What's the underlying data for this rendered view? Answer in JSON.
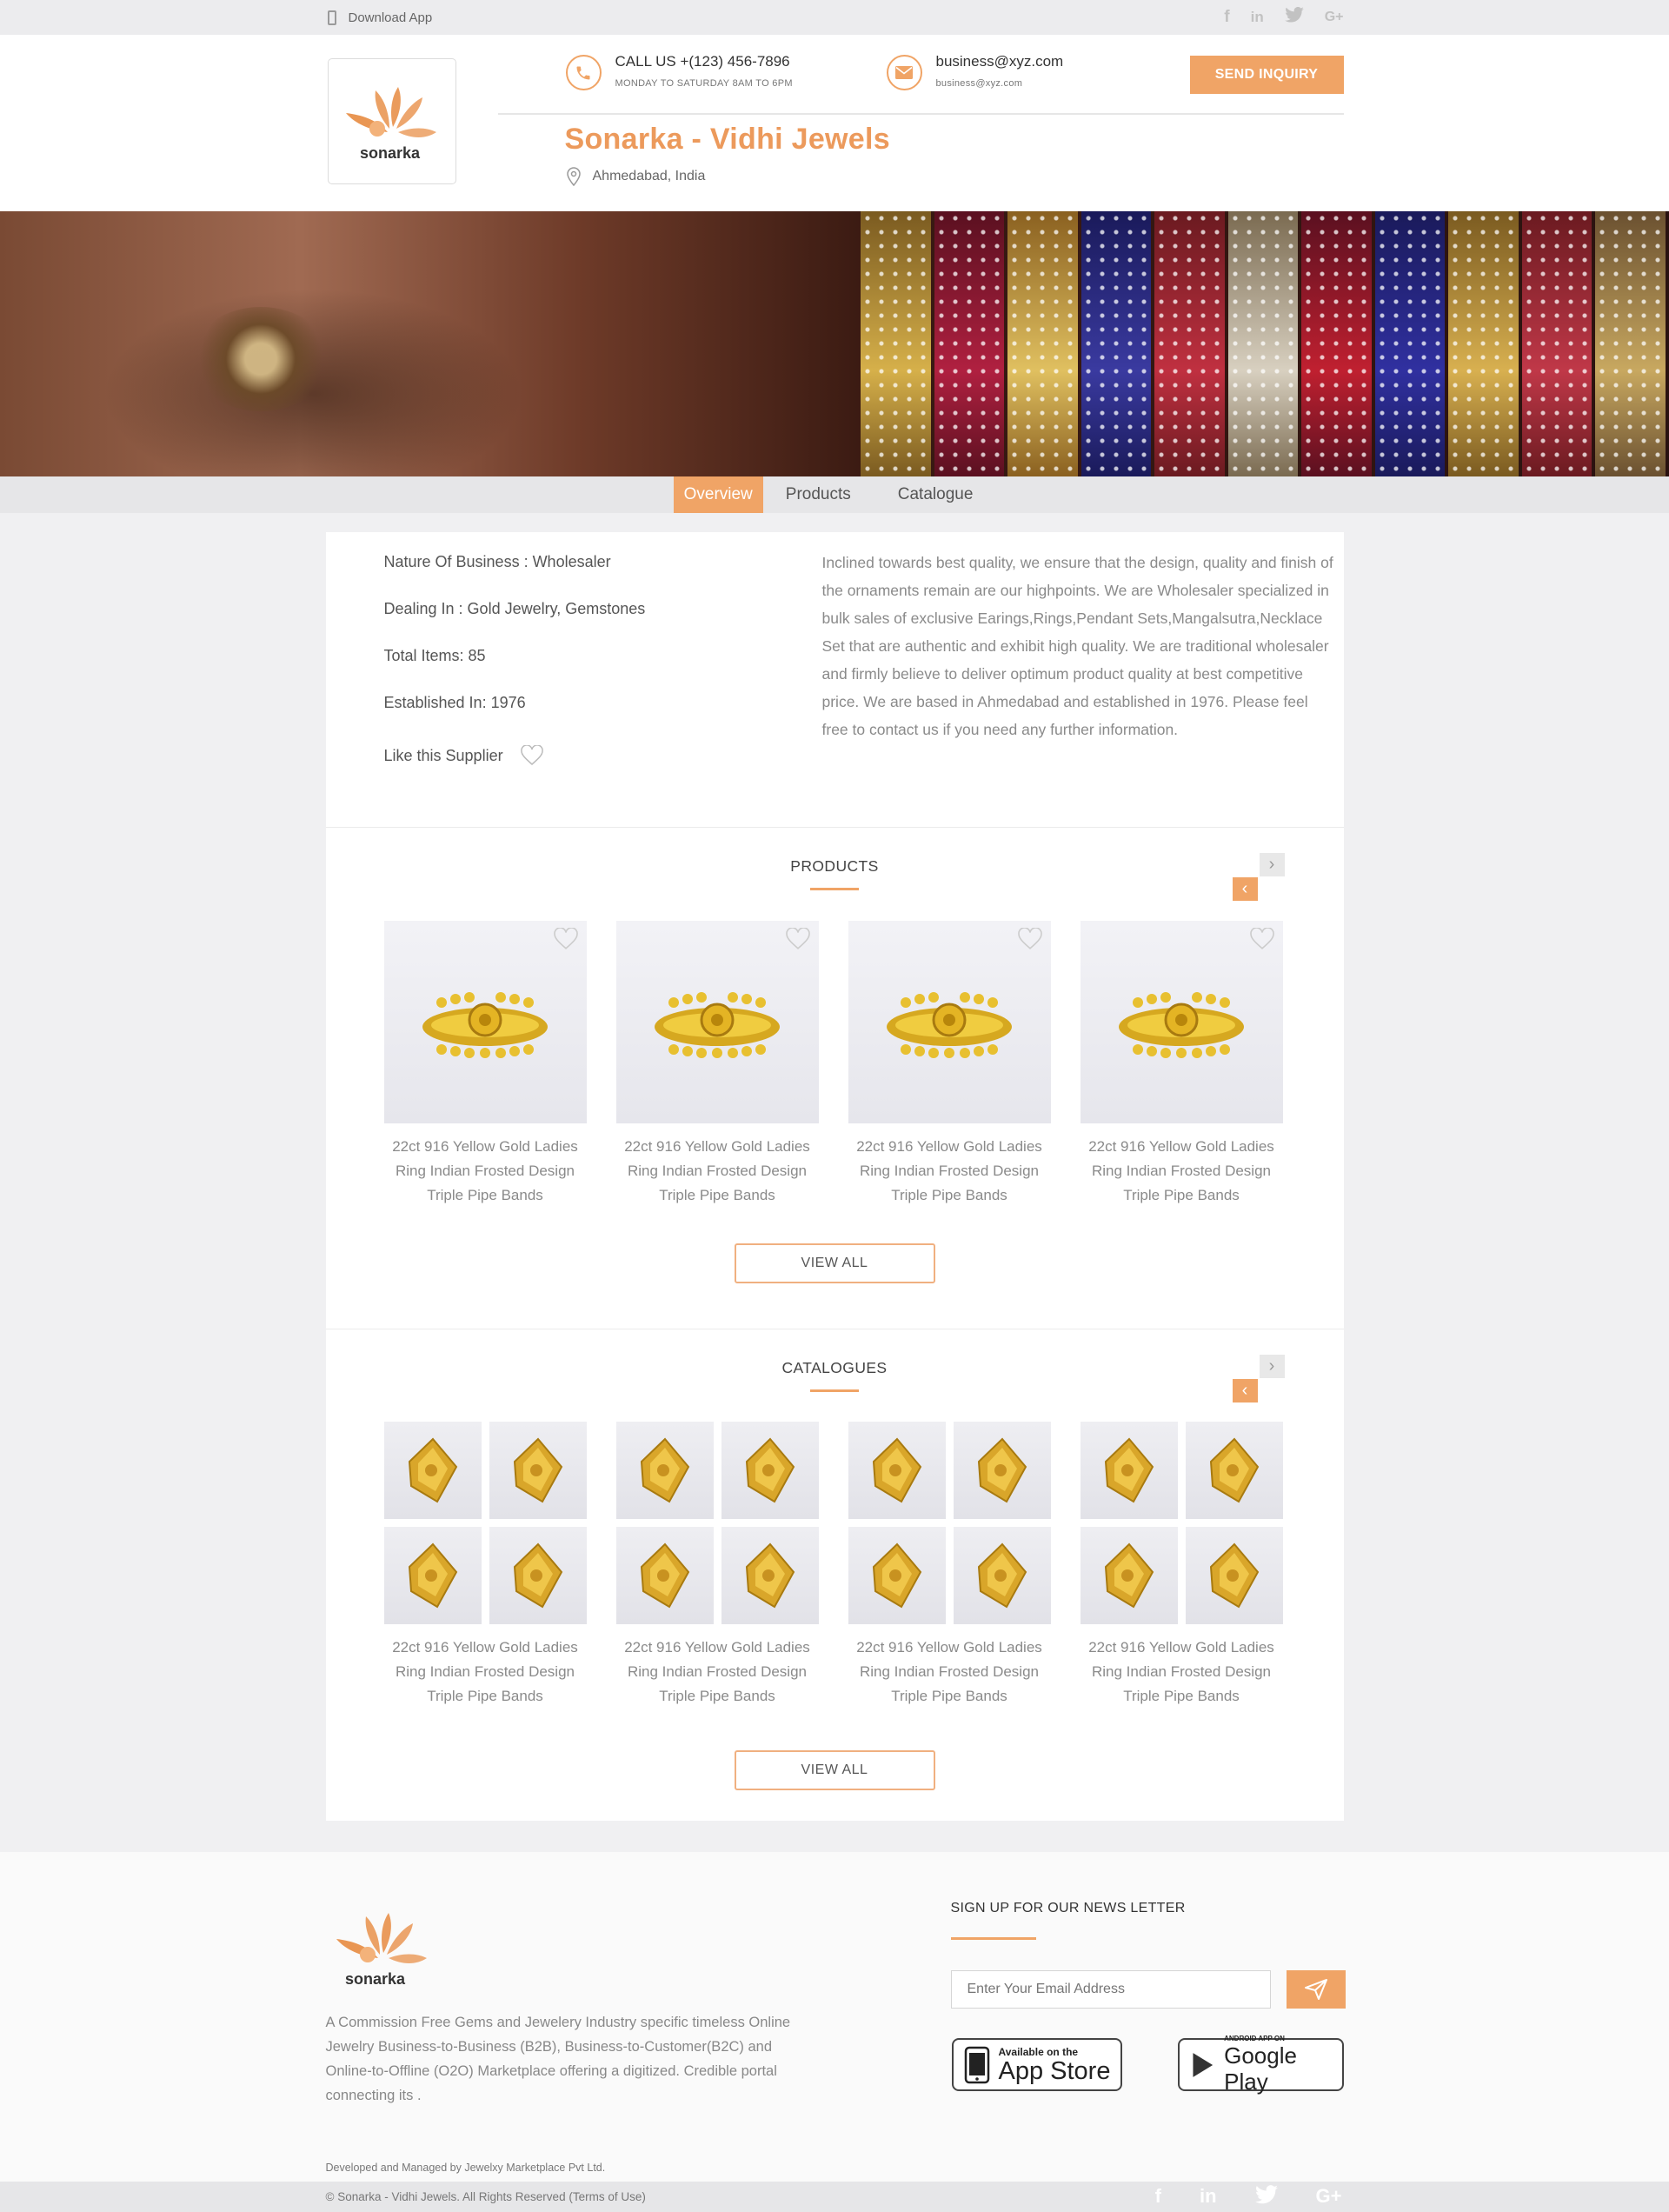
{
  "topbar": {
    "download_label": "Download App",
    "social": [
      "f",
      "in",
      "twitter-icon",
      "G+"
    ]
  },
  "header": {
    "logo_text": "sonarka",
    "call_label": "CALL US +(123) 456-7896",
    "call_hours": "MONDAY TO SATURDAY 8AM TO 6PM",
    "email_main": "business@xyz.com",
    "email_sub": "business@xyz.com",
    "send_inquiry": "SEND INQUIRY",
    "company_name": "Sonarka - Vidhi Jewels",
    "location": "Ahmedabad, India"
  },
  "tabs": [
    "Overview",
    "Products",
    "Catalogue"
  ],
  "overview": {
    "nature": "Nature Of Business : Wholesaler",
    "dealing": "Dealing In : Gold Jewelry, Gemstones",
    "total_items": "Total Items: 85",
    "established": "Established In: 1976",
    "like_label": "Like this Supplier",
    "description": "Inclined towards best quality, we ensure that the design, quality and finish of the ornaments remain are our highpoints. We are Wholesaler specialized in bulk sales of exclusive Earings,Rings,Pendant Sets,Mangalsutra,Necklace Set that are authentic and exhibit high quality. We are traditional wholesaler and firmly believe to deliver optimum product quality at best competitive price. We are based in Ahmedabad and established in 1976. Please feel free to contact us if you need any further information."
  },
  "products": {
    "title": "PRODUCTS",
    "items": [
      {
        "name": "22ct 916 Yellow Gold Ladies Ring Indian Frosted Design Triple Pipe Bands"
      },
      {
        "name": "22ct 916 Yellow Gold Ladies Ring Indian Frosted Design Triple Pipe Bands"
      },
      {
        "name": "22ct 916 Yellow Gold Ladies Ring Indian Frosted Design Triple Pipe Bands"
      },
      {
        "name": "22ct 916 Yellow Gold Ladies Ring Indian Frosted Design Triple Pipe Bands"
      }
    ],
    "view_all": "VIEW ALL"
  },
  "catalogues": {
    "title": "CATALOGUES",
    "items": [
      {
        "name": "22ct 916 Yellow Gold Ladies Ring Indian Frosted Design Triple Pipe Bands"
      },
      {
        "name": "22ct 916 Yellow Gold Ladies Ring Indian Frosted Design Triple Pipe Bands"
      },
      {
        "name": "22ct 916 Yellow Gold Ladies Ring Indian Frosted Design Triple Pipe Bands"
      },
      {
        "name": "22ct 916 Yellow Gold Ladies Ring Indian Frosted Design Triple Pipe Bands"
      }
    ],
    "view_all": "VIEW ALL"
  },
  "footer": {
    "logo_text": "sonarka",
    "about": "A Commission Free Gems and Jewelery Industry specific timeless Online Jewelry Business-to-Business (B2B), Business-to-Customer(B2C) and Online-to-Offline (O2O) Marketplace offering a digitized. Credible portal connecting its .",
    "developed": "Developed and Managed by Jewelxy Marketplace Pvt Ltd.",
    "newsletter_title": "SIGN UP FOR OUR NEWS LETTER",
    "email_placeholder": "Enter Your Email Address",
    "appstore_small": "Available on the",
    "appstore_big": "App Store",
    "play_small": "ANDROID APP ON",
    "play_big": "Google Play",
    "copyright": "© Sonarka - Vidhi Jewels. All Rights Reserved (Terms of Use)"
  },
  "colors": {
    "accent": "#f0a466",
    "brand_title": "#ec9a5c"
  }
}
